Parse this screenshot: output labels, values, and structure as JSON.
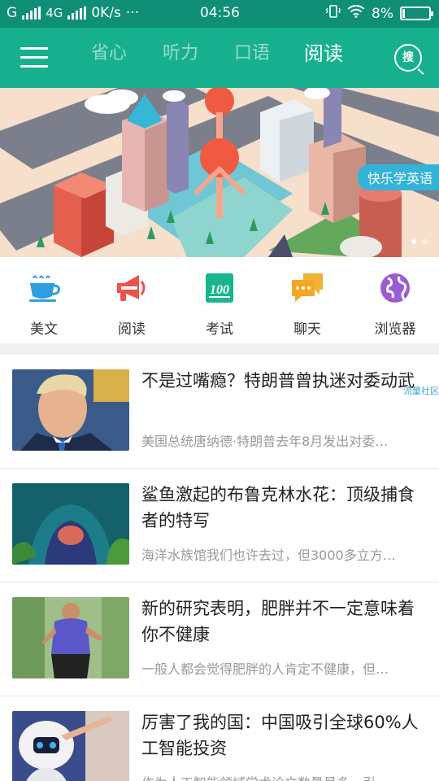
{
  "status_bar": {
    "carrier1": "G",
    "carrier2": "4G",
    "speed": "0K/s",
    "more": "···",
    "time": "04:56",
    "battery": "8%",
    "battery_level": 0.08
  },
  "header": {
    "tabs": [
      {
        "label": "省心"
      },
      {
        "label": "听力"
      },
      {
        "label": "口语"
      },
      {
        "label": "阅读"
      }
    ],
    "active_tab": "阅读",
    "search_label": "搜"
  },
  "banner": {
    "tag": "快乐学英语",
    "page_count": 2,
    "current_page": 1
  },
  "quick_nav": [
    {
      "label": "美文",
      "icon": "coffee-cup-icon",
      "color": "#2d9ee0"
    },
    {
      "label": "阅读",
      "icon": "megaphone-icon",
      "color": "#f0504a"
    },
    {
      "label": "考试",
      "icon": "score-100-icon",
      "color": "#19b58e"
    },
    {
      "label": "聊天",
      "icon": "chat-bubbles-icon",
      "color": "#f5a623"
    },
    {
      "label": "浏览器",
      "icon": "globe-icon",
      "color": "#9b5bd6"
    }
  ],
  "articles": [
    {
      "title": "不是过嘴瘾？特朗普曾执迷对委动武",
      "summary": "美国总统唐纳德·特朗普去年8月发出对委…"
    },
    {
      "title": "鲨鱼激起的布鲁克林水花：顶级捕食者的特写",
      "summary": "海洋水族馆我们也许去过，但3000多立方…"
    },
    {
      "title": "新的研究表明，肥胖并不一定意味着你不健康",
      "summary": "一般人都会觉得肥胖的人肯定不健康，但…"
    },
    {
      "title": "厉害了我的国：中国吸引全球60%人工智能投资",
      "summary": "作为人工智能领域学术论文数量最多，引…"
    }
  ],
  "watermark": "流量社区"
}
